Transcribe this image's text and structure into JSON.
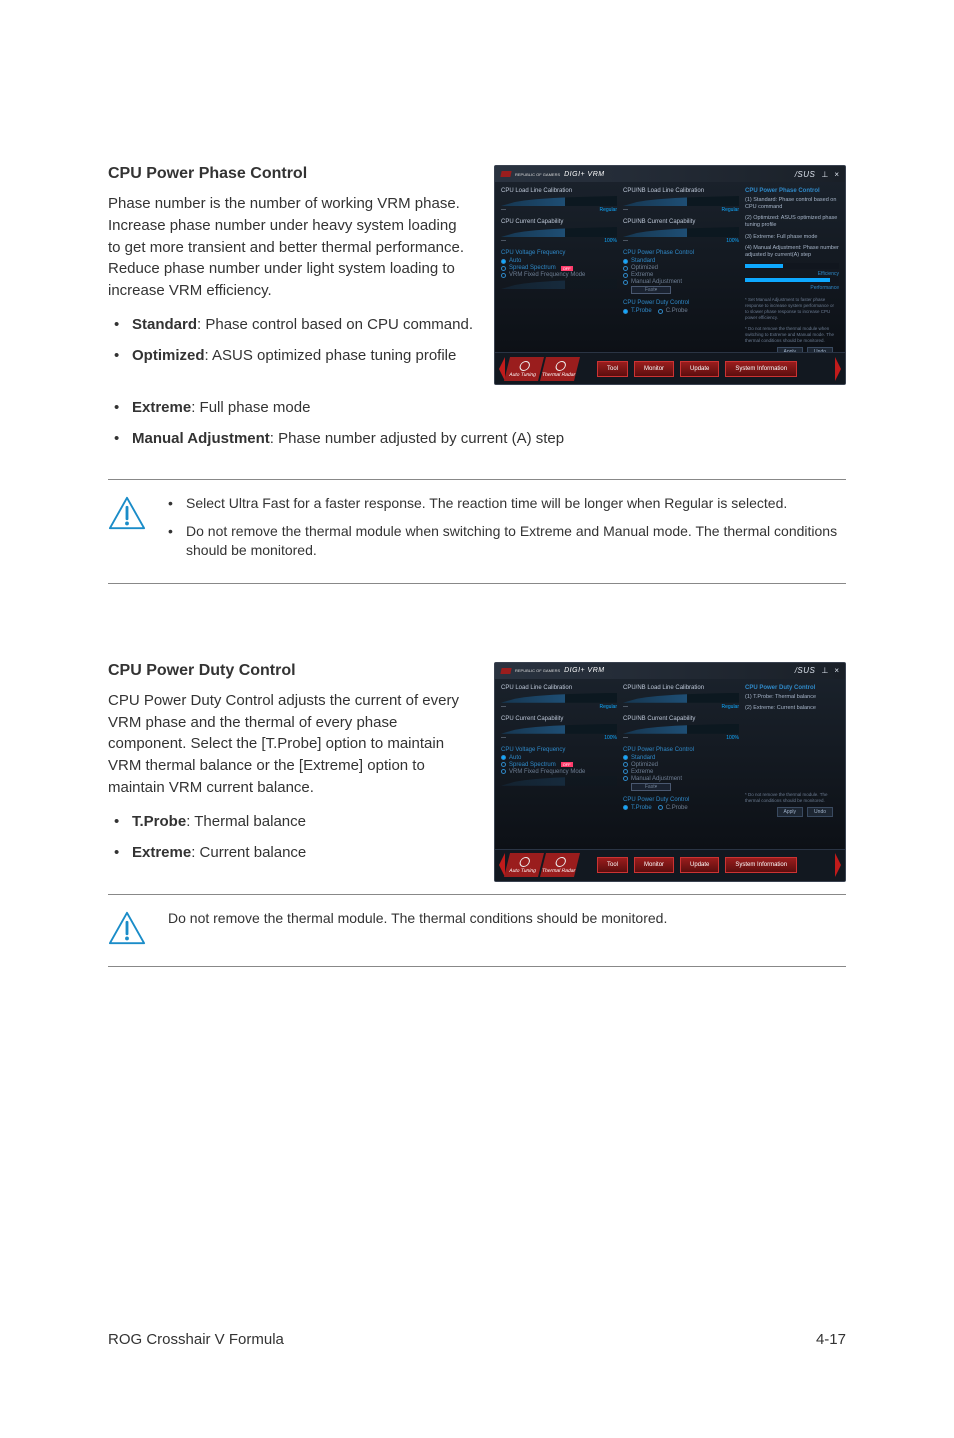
{
  "section1": {
    "title": "CPU Power Phase Control",
    "intro": "Phase number is the number of working VRM phase. Increase phase number under heavy system loading to get more transient and better thermal performance. Reduce phase number under light system loading to increase VRM efficiency.",
    "items": [
      {
        "label": "Standard",
        "desc": ": Phase control based on CPU command."
      },
      {
        "label": "Optimized",
        "desc": ": ASUS optimized phase tuning profile"
      },
      {
        "label": "Extreme",
        "desc": ": Full phase mode"
      },
      {
        "label": "Manual Adjustment",
        "desc": ": Phase number adjusted by current (A) step"
      }
    ],
    "notes": [
      "Select Ultra Fast for a faster response. The reaction time will be longer when Regular is selected.",
      "Do not remove the thermal module when switching to Extreme and Manual mode. The thermal conditions should be monitored."
    ]
  },
  "section2": {
    "title": "CPU Power Duty Control",
    "intro": "CPU Power Duty Control adjusts the current of every VRM phase and the thermal of every phase component. Select the [T.Probe] option to maintain VRM thermal balance or the [Extreme] option to maintain VRM current balance.",
    "items": [
      {
        "label": "T.Probe",
        "desc": ": Thermal balance"
      },
      {
        "label": "Extreme",
        "desc": ": Current balance"
      }
    ],
    "note": "Do not remove the thermal module. The thermal conditions should be monitored."
  },
  "screenshot1": {
    "app_title": "DIGI+ VRM",
    "logo_text": "REPUBLIC OF GAMERS",
    "brand": "/SUS",
    "panels": {
      "cpu_load": "CPU Load Line Calibration",
      "cpu_nb_load": "CPU/NB Load Line Calibration",
      "cpu_current": "CPU Current Capability",
      "cpu_nb_current": "CPU/NB Current Capability",
      "cpu_voltage": "CPU Voltage Frequency",
      "cpu_phase": "CPU Power Phase Control",
      "cpu_duty": "CPU Power Duty Control"
    },
    "slider_vals": {
      "regular": "Regular",
      "pct100": "100%"
    },
    "radios_freq": {
      "auto": "Auto",
      "spread": "Spread Spectrum",
      "spread_toggle": "OFF",
      "vrm_fixed": "VRM Fixed Frequency Mode"
    },
    "radios_phase": {
      "standard": "Standard",
      "optimized": "Optimized",
      "extreme": "Extreme",
      "manual": "Manual Adjustment",
      "fast": "Fast"
    },
    "radios_duty": {
      "tprobe": "T.Probe",
      "cprobe": "C.Probe"
    },
    "right": {
      "title": "CPU Power Phase Control",
      "item1": "(1) Standard: Phase control based on CPU command",
      "item2": "(2) Optimized: ASUS optimized phase tuning profile",
      "item3": "(3) Extreme: Full phase mode",
      "item4": "(4) Manual Adjustment: Phase number adjusted by current(A) step",
      "bar_eff": "Efficiency",
      "bar_perf": "Performance",
      "foot1": "* Set Manual Adjustment to faster phase response to increase system performance or to slower phase response to increase CPU power efficiency.",
      "foot2": "* Do not remove the thermal module when switching to Extreme and Manual mode. The thermal conditions should be monitored."
    },
    "btn_apply": "Apply",
    "btn_undo": "Undo",
    "footer_tabs": {
      "t1": "Auto Tuning",
      "t2": "Thermal Radar"
    },
    "footer_btns": {
      "tool": "Tool",
      "monitor": "Monitor",
      "update": "Update",
      "sysinfo": "System Information"
    }
  },
  "screenshot2": {
    "right": {
      "title": "CPU Power Duty Control",
      "item1": "(1) T.Probe: Thermal balance",
      "item2": "(2) Extreme: Current balance",
      "foot": "* Do not remove the thermal module. The thermal conditions should be monitored."
    }
  },
  "footer": {
    "left": "ROG Crosshair V Formula",
    "right": "4-17"
  },
  "chart_data": {
    "type": "bar",
    "title": "CPU Power Phase Control bars",
    "categories": [
      "Efficiency",
      "Performance"
    ],
    "values": [
      40,
      90
    ],
    "xlabel": "",
    "ylabel": "",
    "ylim": [
      0,
      100
    ]
  }
}
